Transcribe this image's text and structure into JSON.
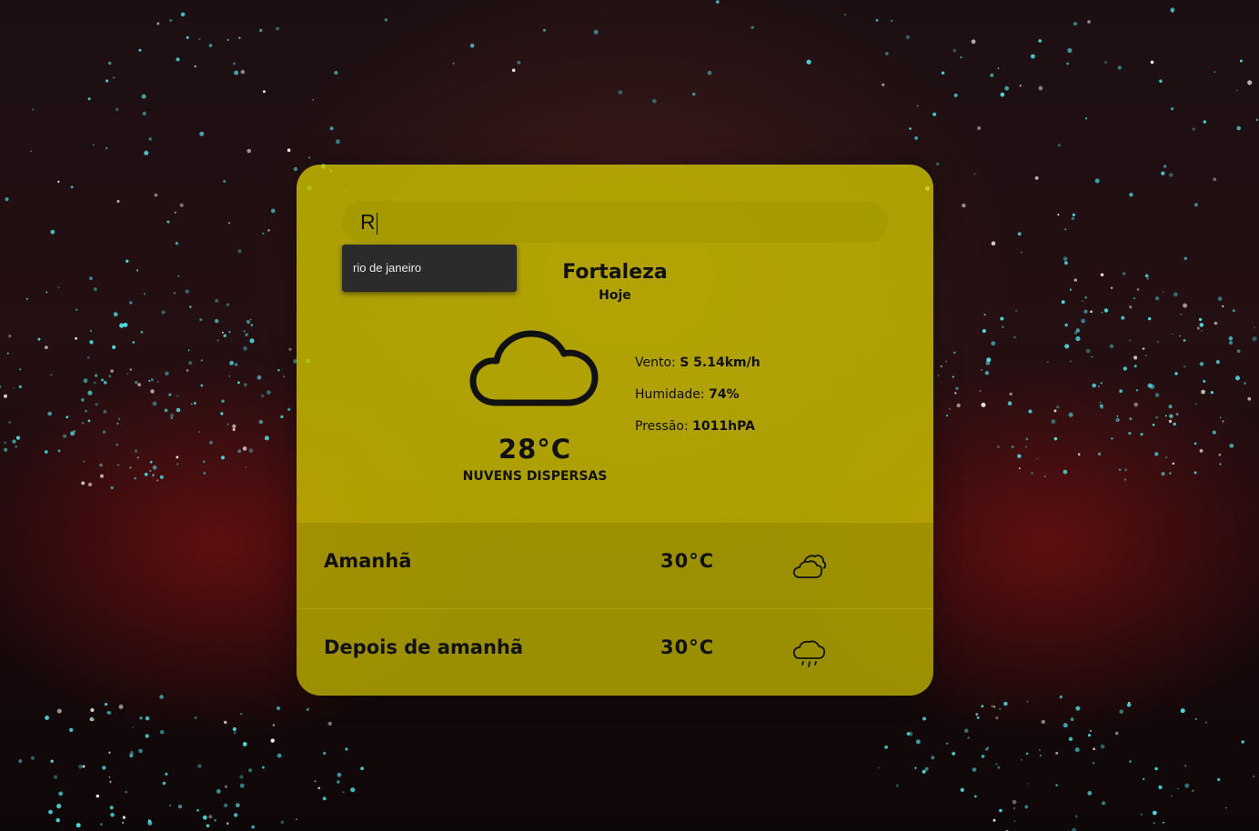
{
  "search": {
    "value": "R"
  },
  "suggestions": [
    "rio de janeiro"
  ],
  "current": {
    "city": "Fortaleza",
    "day": "Hoje",
    "icon": "cloud-icon",
    "temperature": "28°C",
    "description": "NUVENS DISPERSAS",
    "wind_label": "Vento:",
    "wind_value": "S 5.14km/h",
    "humidity_label": "Humidade:",
    "humidity_value": "74%",
    "pressure_label": "Pressão:",
    "pressure_value": "1011hPA"
  },
  "forecast": [
    {
      "label": "Amanhã",
      "temperature": "30°C",
      "icon": "broken-clouds-icon"
    },
    {
      "label": "Depois de amanhã",
      "temperature": "30°C",
      "icon": "rain-cloud-icon"
    }
  ],
  "colors": {
    "card": "#d0c400",
    "text": "#111111",
    "suggestion_bg": "#2b2b2e"
  }
}
